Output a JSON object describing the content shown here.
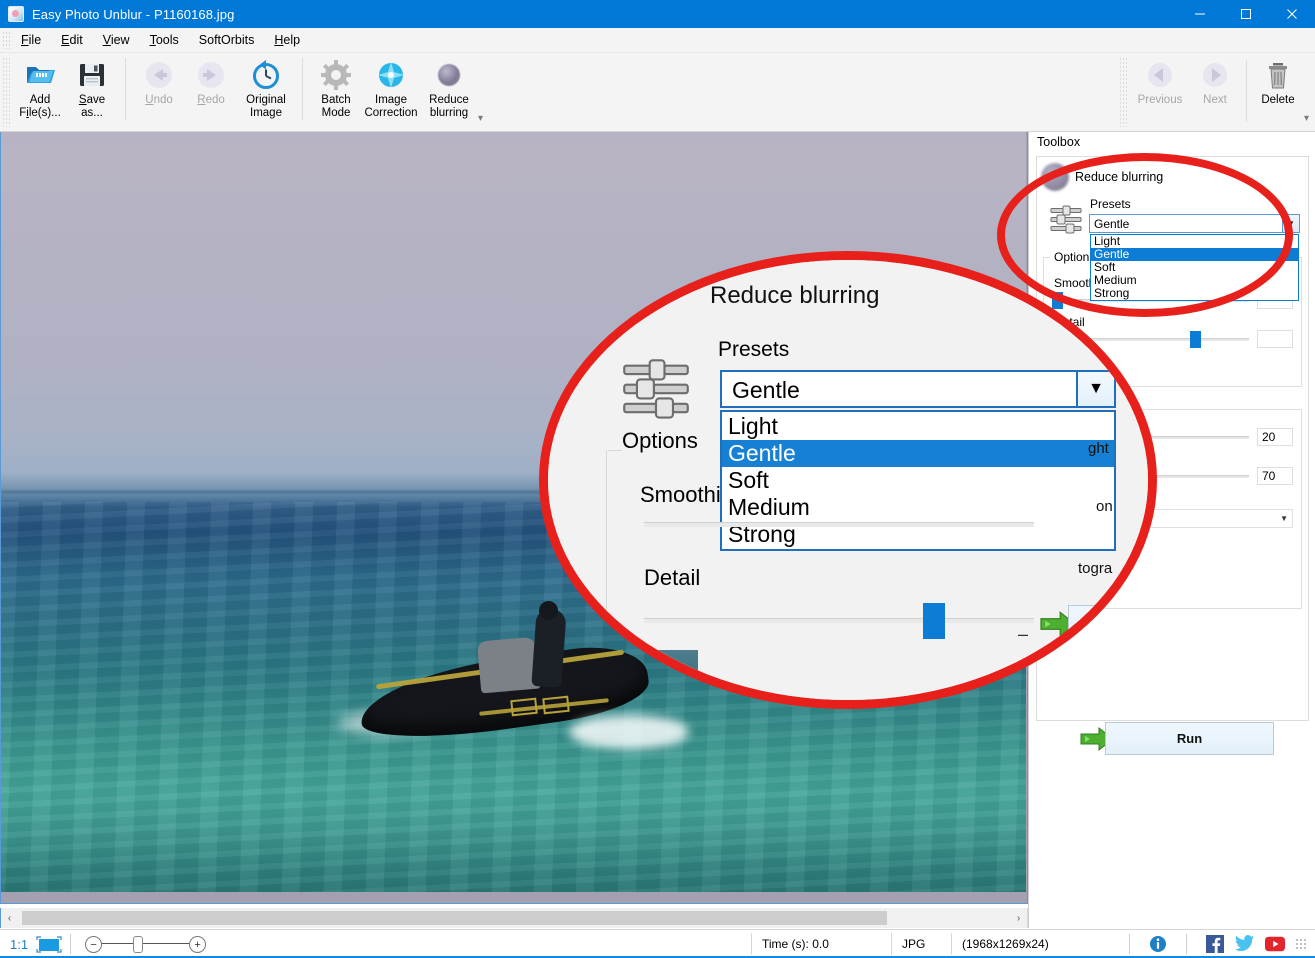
{
  "window": {
    "title": "Easy Photo Unblur - P1160168.jpg",
    "app_icon": "photo-app-icon",
    "minimize": "minimize-icon",
    "maximize": "maximize-icon",
    "close": "close-icon"
  },
  "menu": {
    "items": [
      {
        "label": "File",
        "accel": "F"
      },
      {
        "label": "Edit",
        "accel": "E"
      },
      {
        "label": "View",
        "accel": "V"
      },
      {
        "label": "Tools",
        "accel": "T"
      },
      {
        "label": "SoftOrbits",
        "accel": ""
      },
      {
        "label": "Help",
        "accel": "H"
      }
    ]
  },
  "ribbon": {
    "buttons": [
      {
        "id": "add-files",
        "line1": "Add",
        "line2": "File(s)...",
        "icon": "open-folder-icon",
        "disabled": false
      },
      {
        "id": "save-as",
        "line1": "Save",
        "line2": "as...",
        "icon": "floppy-disk-icon",
        "disabled": false
      },
      {
        "id": "undo",
        "line1": "Undo",
        "line2": "",
        "icon": "undo-arrow-icon",
        "disabled": true
      },
      {
        "id": "redo",
        "line1": "Redo",
        "line2": "",
        "icon": "redo-arrow-icon",
        "disabled": true
      },
      {
        "id": "original-image",
        "line1": "Original",
        "line2": "Image",
        "icon": "clock-history-icon",
        "disabled": false
      },
      {
        "id": "batch-mode",
        "line1": "Batch",
        "line2": "Mode",
        "icon": "gear-icon",
        "disabled": false
      },
      {
        "id": "image-correction",
        "line1": "Image",
        "line2": "Correction",
        "icon": "starburst-icon",
        "disabled": false
      },
      {
        "id": "reduce-blurring",
        "line1": "Reduce",
        "line2": "blurring",
        "icon": "blur-blob-icon",
        "disabled": false
      }
    ],
    "right_buttons": [
      {
        "id": "previous",
        "line1": "Previous",
        "line2": "",
        "icon": "arrow-left-circle-icon",
        "disabled": true
      },
      {
        "id": "next",
        "line1": "Next",
        "line2": "",
        "icon": "arrow-right-circle-icon",
        "disabled": true
      },
      {
        "id": "delete",
        "line1": "Delete",
        "line2": "",
        "icon": "trash-icon",
        "disabled": false
      }
    ],
    "expand_caret": "▾"
  },
  "toolbox": {
    "panel_title": "Toolbox",
    "header_label": "Reduce blurring",
    "header_icon": "blur-blob-icon",
    "sliders_icon": "sliders-icon",
    "presets": {
      "label": "Presets",
      "value": "Gentle",
      "options": [
        "Light",
        "Gentle",
        "Soft",
        "Medium",
        "Strong"
      ],
      "selected_index": 1,
      "open": true,
      "caret": "▼"
    },
    "options_group": {
      "title": "Options",
      "smoothing": {
        "label": "Smoothing",
        "value": "",
        "thumb_pct": 0
      },
      "detail": {
        "label": "Detail",
        "value": "",
        "thumb_pct": 72
      }
    },
    "second_group": {
      "field_a": {
        "value": "20",
        "thumb_pct": 0
      },
      "field_b_label": "ght",
      "field_b": {
        "value": "70",
        "thumb_pct": 24
      },
      "field_c_label": "ong",
      "combo_value": "",
      "combo_caret": "▼",
      "checkbox_label": "togram"
    },
    "run_button": {
      "label": "Run",
      "icon": "green-arrow-icon"
    }
  },
  "magnifier": {
    "title": "Reduce blurring",
    "presets_label": "Presets",
    "presets_value": "Gentle",
    "presets_caret": "▼",
    "options_list": [
      "Light",
      "Gentle",
      "Soft",
      "Medium",
      "Strong"
    ],
    "selected_index": 1,
    "options_group_title": "Options",
    "smoothing_label": "Smoothi",
    "detail_label": "Detail",
    "sliders_icon": "sliders-icon",
    "run_label": "",
    "right_fragments": [
      "ght",
      "on",
      "togra"
    ],
    "annotation_color": "#e8201c"
  },
  "canvas": {
    "photo_alt": "speedboat-on-sea-photo",
    "hscroll_left_arrow": "‹",
    "hscroll_right_arrow": "›"
  },
  "statusbar": {
    "zoom_ratio": "1:1",
    "fit_icon": "fit-to-screen-icon",
    "zoom_out": "−",
    "zoom_in": "+",
    "time_label": "Time (s): 0.0",
    "format": "JPG",
    "dimensions": "(1968x1269x24)",
    "info_icon": "info-icon",
    "facebook_icon": "facebook-icon",
    "twitter_icon": "twitter-icon",
    "youtube_icon": "youtube-icon",
    "resize_grip": "resize-grip-icon"
  },
  "colors": {
    "titlebar": "#0078d7",
    "accent": "#0c7cd5",
    "annotation": "#e8201c",
    "selection": "#1680d4"
  }
}
